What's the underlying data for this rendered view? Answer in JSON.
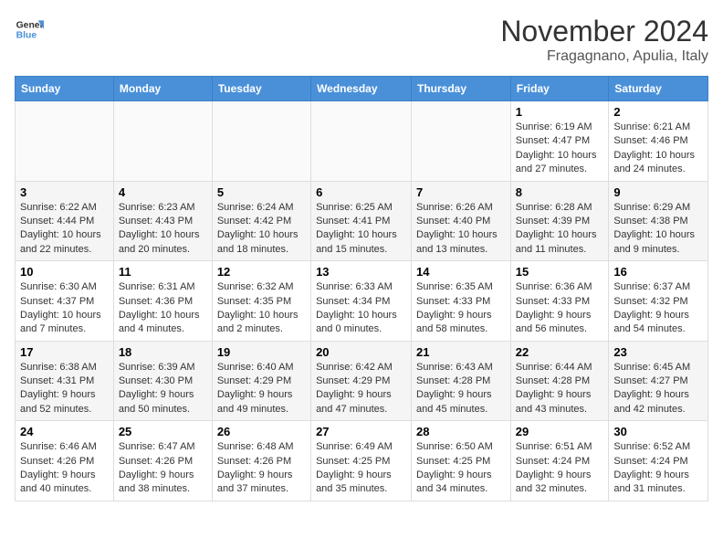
{
  "logo": {
    "line1": "General",
    "line2": "Blue"
  },
  "title": "November 2024",
  "subtitle": "Fragagnano, Apulia, Italy",
  "weekdays": [
    "Sunday",
    "Monday",
    "Tuesday",
    "Wednesday",
    "Thursday",
    "Friday",
    "Saturday"
  ],
  "weeks": [
    [
      {
        "day": "",
        "info": ""
      },
      {
        "day": "",
        "info": ""
      },
      {
        "day": "",
        "info": ""
      },
      {
        "day": "",
        "info": ""
      },
      {
        "day": "",
        "info": ""
      },
      {
        "day": "1",
        "info": "Sunrise: 6:19 AM\nSunset: 4:47 PM\nDaylight: 10 hours and 27 minutes."
      },
      {
        "day": "2",
        "info": "Sunrise: 6:21 AM\nSunset: 4:46 PM\nDaylight: 10 hours and 24 minutes."
      }
    ],
    [
      {
        "day": "3",
        "info": "Sunrise: 6:22 AM\nSunset: 4:44 PM\nDaylight: 10 hours and 22 minutes."
      },
      {
        "day": "4",
        "info": "Sunrise: 6:23 AM\nSunset: 4:43 PM\nDaylight: 10 hours and 20 minutes."
      },
      {
        "day": "5",
        "info": "Sunrise: 6:24 AM\nSunset: 4:42 PM\nDaylight: 10 hours and 18 minutes."
      },
      {
        "day": "6",
        "info": "Sunrise: 6:25 AM\nSunset: 4:41 PM\nDaylight: 10 hours and 15 minutes."
      },
      {
        "day": "7",
        "info": "Sunrise: 6:26 AM\nSunset: 4:40 PM\nDaylight: 10 hours and 13 minutes."
      },
      {
        "day": "8",
        "info": "Sunrise: 6:28 AM\nSunset: 4:39 PM\nDaylight: 10 hours and 11 minutes."
      },
      {
        "day": "9",
        "info": "Sunrise: 6:29 AM\nSunset: 4:38 PM\nDaylight: 10 hours and 9 minutes."
      }
    ],
    [
      {
        "day": "10",
        "info": "Sunrise: 6:30 AM\nSunset: 4:37 PM\nDaylight: 10 hours and 7 minutes."
      },
      {
        "day": "11",
        "info": "Sunrise: 6:31 AM\nSunset: 4:36 PM\nDaylight: 10 hours and 4 minutes."
      },
      {
        "day": "12",
        "info": "Sunrise: 6:32 AM\nSunset: 4:35 PM\nDaylight: 10 hours and 2 minutes."
      },
      {
        "day": "13",
        "info": "Sunrise: 6:33 AM\nSunset: 4:34 PM\nDaylight: 10 hours and 0 minutes."
      },
      {
        "day": "14",
        "info": "Sunrise: 6:35 AM\nSunset: 4:33 PM\nDaylight: 9 hours and 58 minutes."
      },
      {
        "day": "15",
        "info": "Sunrise: 6:36 AM\nSunset: 4:33 PM\nDaylight: 9 hours and 56 minutes."
      },
      {
        "day": "16",
        "info": "Sunrise: 6:37 AM\nSunset: 4:32 PM\nDaylight: 9 hours and 54 minutes."
      }
    ],
    [
      {
        "day": "17",
        "info": "Sunrise: 6:38 AM\nSunset: 4:31 PM\nDaylight: 9 hours and 52 minutes."
      },
      {
        "day": "18",
        "info": "Sunrise: 6:39 AM\nSunset: 4:30 PM\nDaylight: 9 hours and 50 minutes."
      },
      {
        "day": "19",
        "info": "Sunrise: 6:40 AM\nSunset: 4:29 PM\nDaylight: 9 hours and 49 minutes."
      },
      {
        "day": "20",
        "info": "Sunrise: 6:42 AM\nSunset: 4:29 PM\nDaylight: 9 hours and 47 minutes."
      },
      {
        "day": "21",
        "info": "Sunrise: 6:43 AM\nSunset: 4:28 PM\nDaylight: 9 hours and 45 minutes."
      },
      {
        "day": "22",
        "info": "Sunrise: 6:44 AM\nSunset: 4:28 PM\nDaylight: 9 hours and 43 minutes."
      },
      {
        "day": "23",
        "info": "Sunrise: 6:45 AM\nSunset: 4:27 PM\nDaylight: 9 hours and 42 minutes."
      }
    ],
    [
      {
        "day": "24",
        "info": "Sunrise: 6:46 AM\nSunset: 4:26 PM\nDaylight: 9 hours and 40 minutes."
      },
      {
        "day": "25",
        "info": "Sunrise: 6:47 AM\nSunset: 4:26 PM\nDaylight: 9 hours and 38 minutes."
      },
      {
        "day": "26",
        "info": "Sunrise: 6:48 AM\nSunset: 4:26 PM\nDaylight: 9 hours and 37 minutes."
      },
      {
        "day": "27",
        "info": "Sunrise: 6:49 AM\nSunset: 4:25 PM\nDaylight: 9 hours and 35 minutes."
      },
      {
        "day": "28",
        "info": "Sunrise: 6:50 AM\nSunset: 4:25 PM\nDaylight: 9 hours and 34 minutes."
      },
      {
        "day": "29",
        "info": "Sunrise: 6:51 AM\nSunset: 4:24 PM\nDaylight: 9 hours and 32 minutes."
      },
      {
        "day": "30",
        "info": "Sunrise: 6:52 AM\nSunset: 4:24 PM\nDaylight: 9 hours and 31 minutes."
      }
    ]
  ]
}
